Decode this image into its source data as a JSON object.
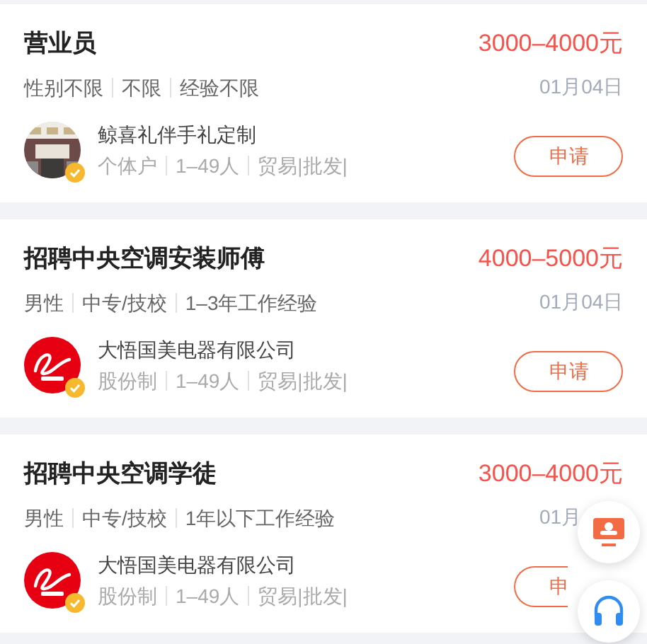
{
  "jobs": [
    {
      "title": "营业员",
      "salary": "3000–4000元",
      "tags": [
        "性别不限",
        "不限",
        "经验不限"
      ],
      "date": "01月04日",
      "company": {
        "name": "鲸喜礼伴手礼定制",
        "verified": true,
        "info": [
          "个体户",
          "1–49人",
          "贸易|批发|"
        ]
      },
      "apply_label": "申请"
    },
    {
      "title": "招聘中央空调安装师傅",
      "salary": "4000–5000元",
      "tags": [
        "男性",
        "中专/技校",
        "1–3年工作经验"
      ],
      "date": "01月04日",
      "company": {
        "name": "大悟国美电器有限公司",
        "logo": {
          "kind": "brand"
        },
        "verified": true,
        "info": [
          "股份制",
          "1–49人",
          "贸易|批发|"
        ]
      },
      "apply_label": "申请"
    },
    {
      "title": "招聘中央空调学徒",
      "salary": "3000–4000元",
      "tags": [
        "男性",
        "中专/技校",
        "1年以下工作经验"
      ],
      "date": "01月",
      "company": {
        "name": "大悟国美电器有限公司",
        "logo": {
          "kind": "brand"
        },
        "verified": true,
        "info": [
          "股份制",
          "1–49人",
          "贸易|批发|"
        ]
      },
      "apply_label": "申"
    }
  ],
  "floating_buttons": [
    {
      "kind": "screen"
    },
    {
      "kind": "headset"
    }
  ]
}
